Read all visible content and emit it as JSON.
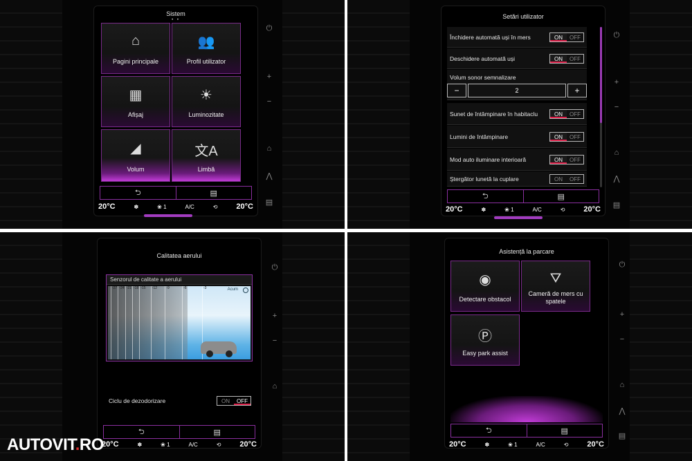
{
  "sistem": {
    "title": "Sistem",
    "tiles": [
      {
        "label": "Pagini principale",
        "icon": "home-icon"
      },
      {
        "label": "Profil utilizator",
        "icon": "users-icon"
      },
      {
        "label": "Afișaj",
        "icon": "display-icon"
      },
      {
        "label": "Luminozitate",
        "icon": "brightness-icon"
      },
      {
        "label": "Volum",
        "icon": "volume-icon"
      },
      {
        "label": "Limbă",
        "icon": "language-icon"
      }
    ]
  },
  "setari": {
    "title": "Setări utilizator",
    "rows": [
      {
        "label": "Închidere automată uși în mers",
        "on": "ON",
        "off": "OFF"
      },
      {
        "label": "Deschidere automată uși",
        "on": "ON",
        "off": "OFF"
      },
      {
        "label": "Sunet de întâmpinare în habitaclu",
        "on": "ON",
        "off": "OFF"
      },
      {
        "label": "Lumini de întâmpinare",
        "on": "ON",
        "off": "OFF"
      },
      {
        "label": "Mod auto iluminare interioară",
        "on": "ON",
        "off": "OFF"
      },
      {
        "label": "Ștergător lunetă la cuplare",
        "on": "ON",
        "off": "OFF"
      }
    ],
    "volume": {
      "label": "Volum sonor semnalizare",
      "minus": "−",
      "value": "2",
      "plus": "+"
    }
  },
  "aer": {
    "title": "Calitatea aerului",
    "panel_title": "Senzorul de calitate a aerului",
    "ticks": [
      "-27",
      "-24",
      "-21",
      "-18",
      "-15",
      "-12",
      "-9",
      "-6",
      "-3"
    ],
    "now": "Acum",
    "dezo": {
      "label": "Ciclu de dezodorizare",
      "on": "ON",
      "off": "OFF"
    }
  },
  "parcare": {
    "title": "Asistență la parcare",
    "tiles": [
      {
        "label": "Detectare obstacol",
        "icon": "obstacle-sensor-icon"
      },
      {
        "label": "Cameră de mers cu spatele",
        "icon": "rear-camera-icon"
      },
      {
        "label": "Easy park assist",
        "icon": "park-assist-icon"
      }
    ]
  },
  "climate": {
    "temp_left": "20°C",
    "temp_right": "20°C",
    "fan": "1",
    "ac": "A/C"
  },
  "nav": {
    "back": "⮌",
    "menu": "▤"
  },
  "watermark": {
    "brand": "AUTOVIT",
    "dot": ".",
    "tld": "RO"
  }
}
